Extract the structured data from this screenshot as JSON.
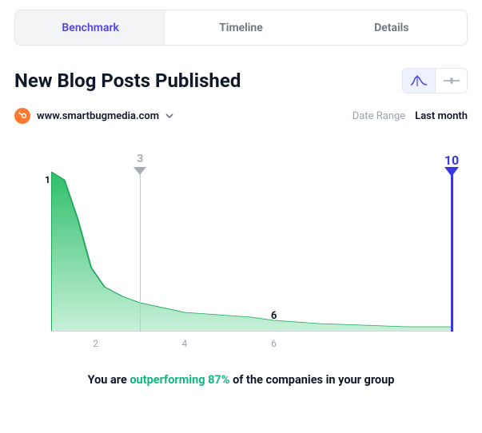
{
  "tabs": {
    "benchmark": "Benchmark",
    "timeline": "Timeline",
    "details": "Details"
  },
  "title": "New Blog Posts Published",
  "domain": {
    "name": "www.smartbugmedia.com"
  },
  "date_range": {
    "label": "Date Range",
    "value": "Last month"
  },
  "markers": {
    "median": {
      "value": "3"
    },
    "you": {
      "value": "10"
    },
    "peak_y": "1",
    "tail_x": "6"
  },
  "x_ticks": {
    "t2": "2",
    "t4": "4",
    "t6": "6"
  },
  "summary": {
    "prefix": "You are ",
    "highlight": "outperforming 87%",
    "suffix": " of the companies in your group"
  },
  "colors": {
    "accent": "#3b37e0",
    "green_fill_top": "#34d07a",
    "green_fill_bot": "#a7e9c4",
    "gray": "#a8adb7"
  },
  "chart_data": {
    "type": "area",
    "title": "New Blog Posts Published",
    "xlabel": "",
    "ylabel": "",
    "xlim": [
      1,
      10
    ],
    "ylim": [
      0,
      1
    ],
    "x_ticks": [
      2,
      4,
      6
    ],
    "series": [
      {
        "name": "distribution",
        "x": [
          1.0,
          1.3,
          1.6,
          1.9,
          2.2,
          2.6,
          3.0,
          3.5,
          4.0,
          4.5,
          5.0,
          5.5,
          6.0,
          7.0,
          8.0,
          9.0,
          10.0
        ],
        "values": [
          1.0,
          0.95,
          0.7,
          0.4,
          0.28,
          0.22,
          0.18,
          0.15,
          0.12,
          0.11,
          0.1,
          0.09,
          0.07,
          0.05,
          0.04,
          0.03,
          0.03
        ]
      }
    ],
    "annotations": [
      {
        "kind": "vline",
        "x": 3,
        "label": "3",
        "color": "#a8adb7",
        "role": "median"
      },
      {
        "kind": "vline",
        "x": 10,
        "label": "10",
        "color": "#3b37e0",
        "role": "you"
      },
      {
        "kind": "point_label",
        "x": 1,
        "y": 1.0,
        "text": "1"
      },
      {
        "kind": "point_label",
        "x": 6,
        "y": 0.07,
        "text": "6"
      }
    ]
  }
}
